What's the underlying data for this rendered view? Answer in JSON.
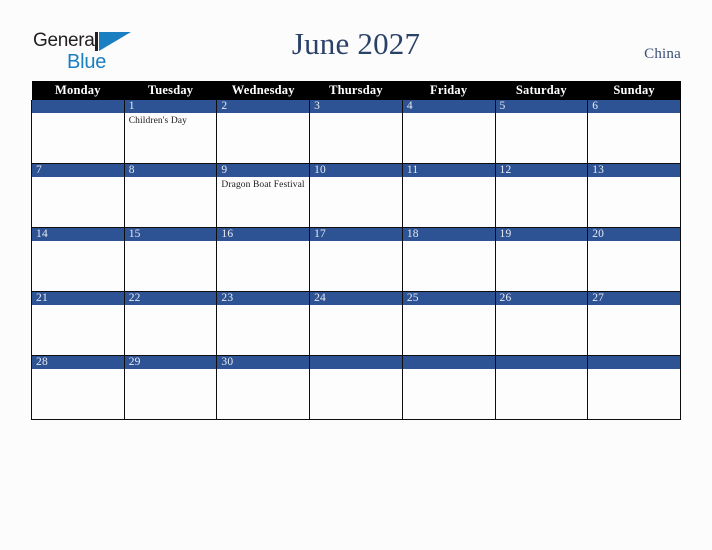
{
  "brand": {
    "name_top": "General",
    "name_bottom": "Blue",
    "triangle_icon": "blue-triangle-icon",
    "color_dark": "#231f20",
    "color_blue": "#1a7fc1"
  },
  "header": {
    "title": "June 2027",
    "country": "China",
    "title_color": "#2b4268"
  },
  "calendar": {
    "accent_color": "#2d5394",
    "header_bg": "#000000",
    "weekday_headers": [
      "Monday",
      "Tuesday",
      "Wednesday",
      "Thursday",
      "Friday",
      "Saturday",
      "Sunday"
    ],
    "weeks": [
      [
        {
          "day": "",
          "events": []
        },
        {
          "day": "1",
          "events": [
            "Children's Day"
          ]
        },
        {
          "day": "2",
          "events": []
        },
        {
          "day": "3",
          "events": []
        },
        {
          "day": "4",
          "events": []
        },
        {
          "day": "5",
          "events": []
        },
        {
          "day": "6",
          "events": []
        }
      ],
      [
        {
          "day": "7",
          "events": []
        },
        {
          "day": "8",
          "events": []
        },
        {
          "day": "9",
          "events": [
            "Dragon Boat Festival"
          ]
        },
        {
          "day": "10",
          "events": []
        },
        {
          "day": "11",
          "events": []
        },
        {
          "day": "12",
          "events": []
        },
        {
          "day": "13",
          "events": []
        }
      ],
      [
        {
          "day": "14",
          "events": []
        },
        {
          "day": "15",
          "events": []
        },
        {
          "day": "16",
          "events": []
        },
        {
          "day": "17",
          "events": []
        },
        {
          "day": "18",
          "events": []
        },
        {
          "day": "19",
          "events": []
        },
        {
          "day": "20",
          "events": []
        }
      ],
      [
        {
          "day": "21",
          "events": []
        },
        {
          "day": "22",
          "events": []
        },
        {
          "day": "23",
          "events": []
        },
        {
          "day": "24",
          "events": []
        },
        {
          "day": "25",
          "events": []
        },
        {
          "day": "26",
          "events": []
        },
        {
          "day": "27",
          "events": []
        }
      ],
      [
        {
          "day": "28",
          "events": []
        },
        {
          "day": "29",
          "events": []
        },
        {
          "day": "30",
          "events": []
        },
        {
          "day": "",
          "events": []
        },
        {
          "day": "",
          "events": []
        },
        {
          "day": "",
          "events": []
        },
        {
          "day": "",
          "events": []
        }
      ]
    ]
  }
}
